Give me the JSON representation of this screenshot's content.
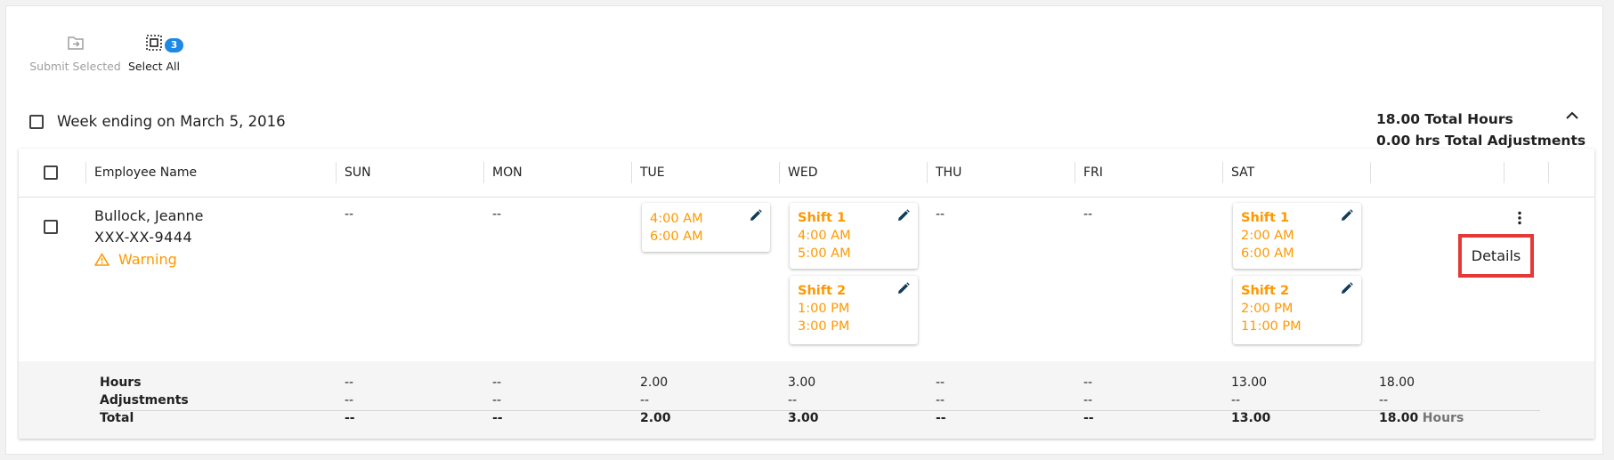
{
  "toolbar": {
    "submit_label": "Submit Selected",
    "select_all_label": "Select All",
    "select_count": "3"
  },
  "week": {
    "label": "Week ending on March 5, 2016",
    "total_hours": "18.00 Total Hours",
    "total_adjustments": "0.00 hrs Total Adjustments"
  },
  "table": {
    "headers": [
      "Employee Name",
      "SUN",
      "MON",
      "TUE",
      "WED",
      "THU",
      "FRI",
      "SAT"
    ],
    "employee": {
      "name": "Bullock, Jeanne",
      "ssn": "XXX-XX-9444",
      "status": "Warning"
    },
    "days": {
      "sun": "--",
      "mon": "--",
      "thu": "--",
      "fri": "--"
    },
    "shifts": {
      "tue": [
        {
          "start": "4:00 AM",
          "end": "6:00 AM"
        }
      ],
      "wed": [
        {
          "name": "Shift 1",
          "start": "4:00 AM",
          "end": "5:00 AM"
        },
        {
          "name": "Shift 2",
          "start": "1:00 PM",
          "end": "3:00 PM"
        }
      ],
      "sat": [
        {
          "name": "Shift 1",
          "start": "2:00 AM",
          "end": "6:00 AM"
        },
        {
          "name": "Shift 2",
          "start": "2:00 PM",
          "end": "11:00 PM"
        }
      ]
    },
    "details_label": "Details"
  },
  "summary": {
    "labels": {
      "hours": "Hours",
      "adjustments": "Adjustments",
      "total": "Total"
    },
    "hours": [
      "--",
      "--",
      "2.00",
      "3.00",
      "--",
      "--",
      "13.00",
      "18.00"
    ],
    "adjustments": [
      "--",
      "--",
      "--",
      "--",
      "--",
      "--",
      "--",
      "--"
    ],
    "total": [
      "--",
      "--",
      "2.00",
      "3.00",
      "--",
      "--",
      "13.00",
      "18.00"
    ],
    "total_unit": "Hours"
  },
  "colors": {
    "accent_warning": "#ff9800",
    "badge": "#1e88e5",
    "highlight_box": "#e53935"
  }
}
